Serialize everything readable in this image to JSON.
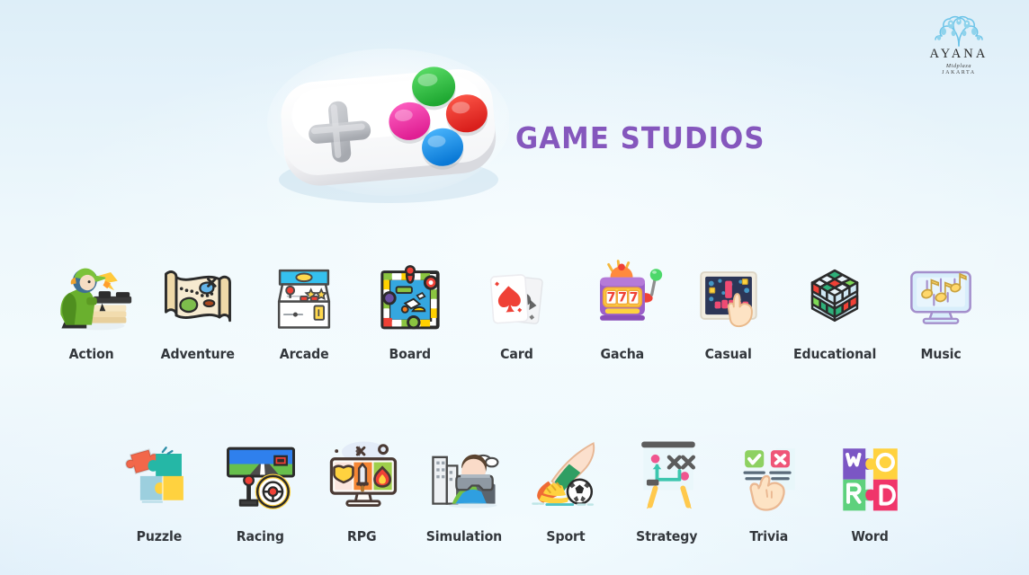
{
  "brand": {
    "name": "AYANA",
    "sub1": "Midplaza",
    "sub2": "JAKARTA",
    "mark_icon": "coral-tree-icon"
  },
  "hero": {
    "title": "GAME STUDIOS",
    "title_color": "#8557bd",
    "gamepad_icon": "gamepad-icon",
    "gamepad_buttons": [
      "green",
      "pink",
      "red",
      "blue"
    ]
  },
  "background": {
    "top_color": "#ddeef8",
    "mid_color": "#f2fafd",
    "bottom_color": "#e0effa"
  },
  "categories": {
    "row1": [
      {
        "label": "Action",
        "icon": "soldier-gun-icon"
      },
      {
        "label": "Adventure",
        "icon": "treasure-map-icon"
      },
      {
        "label": "Arcade",
        "icon": "arcade-cabinet-icon"
      },
      {
        "label": "Board",
        "icon": "board-game-icon"
      },
      {
        "label": "Card",
        "icon": "playing-cards-icon"
      },
      {
        "label": "Gacha",
        "icon": "slot-machine-777-icon"
      },
      {
        "label": "Casual",
        "icon": "tap-game-screen-icon"
      },
      {
        "label": "Educational",
        "icon": "rubiks-cube-icon"
      },
      {
        "label": "Music",
        "icon": "music-monitor-icon"
      }
    ],
    "row2": [
      {
        "label": "Puzzle",
        "icon": "jigsaw-pieces-icon"
      },
      {
        "label": "Racing",
        "icon": "steering-wheel-icon"
      },
      {
        "label": "RPG",
        "icon": "rpg-monitor-icon"
      },
      {
        "label": "Simulation",
        "icon": "vr-headset-person-icon"
      },
      {
        "label": "Sport",
        "icon": "soccer-kick-icon"
      },
      {
        "label": "Strategy",
        "icon": "whiteboard-tactics-icon"
      },
      {
        "label": "Trivia",
        "icon": "quiz-check-cross-icon"
      },
      {
        "label": "Word",
        "icon": "word-puzzle-tiles-icon"
      }
    ]
  }
}
